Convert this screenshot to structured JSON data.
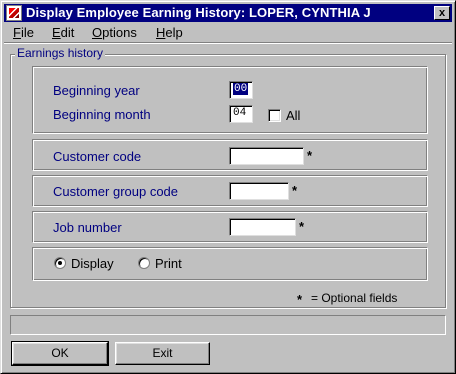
{
  "window": {
    "title": "Display Employee Earning History:  LOPER, CYNTHIA J",
    "close_label": "x"
  },
  "menu": [
    {
      "mnemonic": "F",
      "rest": "ile"
    },
    {
      "mnemonic": "E",
      "rest": "dit"
    },
    {
      "mnemonic": "O",
      "rest": "ptions"
    },
    {
      "mnemonic": "H",
      "rest": "elp"
    }
  ],
  "group_title": "Earnings history",
  "form": {
    "beginning_year": {
      "label": "Beginning year",
      "value": "00"
    },
    "beginning_month": {
      "label": "Beginning month",
      "value": "04"
    },
    "all": {
      "label": "All",
      "checked": false
    },
    "customer_code": {
      "label": "Customer code",
      "value": "",
      "marker": "*"
    },
    "customer_group_code": {
      "label": "Customer group code",
      "value": "",
      "marker": "*"
    },
    "job_number": {
      "label": "Job number",
      "value": "",
      "marker": "*"
    },
    "output": {
      "options": [
        "Display",
        "Print"
      ],
      "selected": "Display"
    }
  },
  "legend": {
    "marker": "*",
    "text": "= Optional fields"
  },
  "status_text": "",
  "buttons": {
    "ok": "OK",
    "exit": "Exit"
  }
}
